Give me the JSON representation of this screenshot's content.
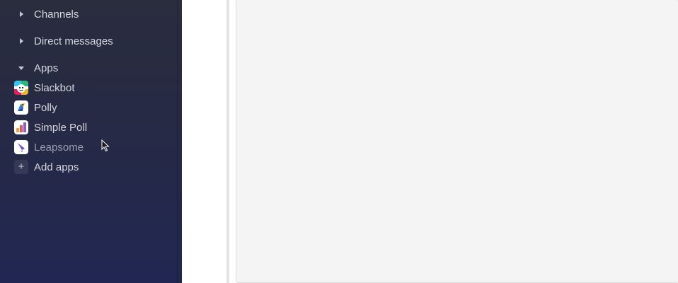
{
  "sidebar": {
    "sections": [
      {
        "label": "Channels",
        "state": "collapsed"
      },
      {
        "label": "Direct messages",
        "state": "collapsed"
      },
      {
        "label": "Apps",
        "state": "expanded"
      }
    ],
    "apps": [
      {
        "label": "Slackbot",
        "icon": "slackbot-icon"
      },
      {
        "label": "Polly",
        "icon": "polly-icon"
      },
      {
        "label": "Simple Poll",
        "icon": "simple-poll-icon"
      },
      {
        "label": "Leapsome",
        "icon": "leapsome-icon"
      }
    ],
    "add_apps": {
      "label": "Add apps",
      "icon": "plus-icon"
    }
  },
  "colors": {
    "sidebar_top": "#2a2d3e",
    "sidebar_bottom": "#212752",
    "content_bg": "#f4f4f4"
  }
}
